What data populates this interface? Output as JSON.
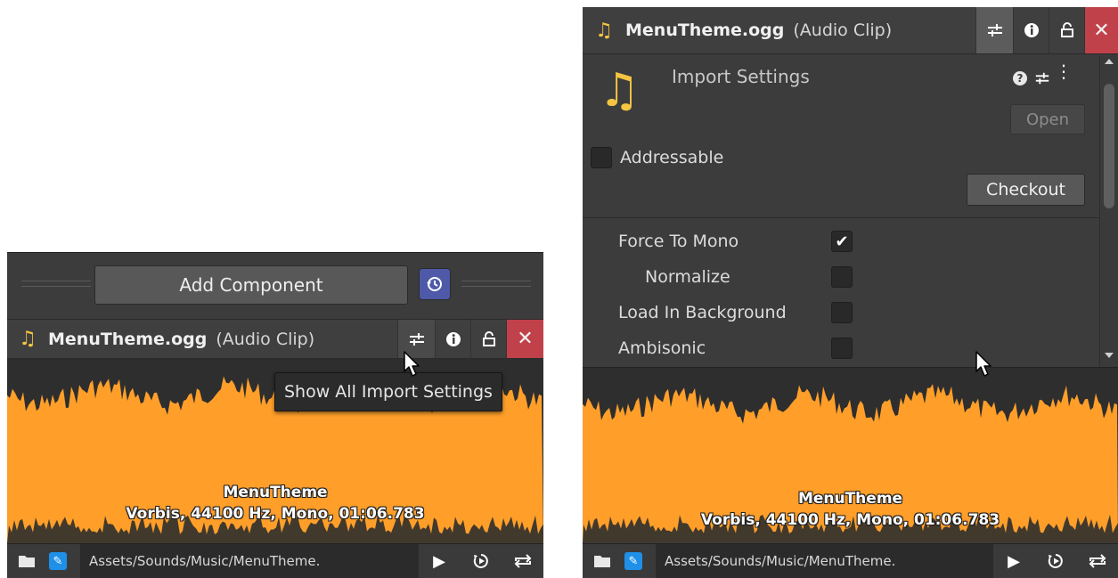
{
  "add_component": {
    "label": "Add Component"
  },
  "audio_header": {
    "filename": "MenuTheme.ogg",
    "type": "(Audio Clip)",
    "icons": [
      "music-note-icon",
      "import-settings-sliders-icon",
      "info-icon",
      "lock-icon",
      "close-icon"
    ]
  },
  "tooltip": {
    "text": "Show All Import Settings"
  },
  "waveform": {
    "title": "MenuTheme",
    "info": "Vorbis, 44100 Hz, Mono, 01:06.783",
    "color": "#ff9f2a",
    "background": "#2e2e2e"
  },
  "bottom_bar": {
    "path": "Assets/Sounds/Music/MenuTheme.",
    "icons": [
      "folder-icon",
      "edit-icon",
      "play-icon",
      "autoplay-icon",
      "loop-icon"
    ]
  },
  "import_settings": {
    "title": "Import Settings",
    "open_label": "Open",
    "checkout_label": "Checkout",
    "addressable_label": "Addressable",
    "options": [
      {
        "label": "Force To Mono",
        "checked": true,
        "indent": false
      },
      {
        "label": "Normalize",
        "checked": false,
        "indent": true
      },
      {
        "label": "Load In Background",
        "checked": false,
        "indent": false
      },
      {
        "label": "Ambisonic",
        "checked": false,
        "indent": false
      }
    ]
  },
  "colors": {
    "panel": "#3c3c3c",
    "header": "#3f3f3f",
    "close": "#c1414a",
    "accent_blue": "#1e90e8",
    "note": "#f4c542"
  }
}
